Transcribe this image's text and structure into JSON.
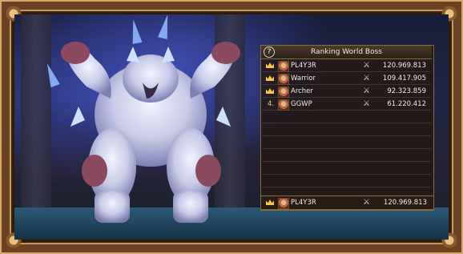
{
  "panel": {
    "title": "Ranking World Boss",
    "help_icon": "question-circle-icon",
    "rows": [
      {
        "rank": "",
        "name": "PL4Y3R",
        "score": "120.969.813"
      },
      {
        "rank": "",
        "name": "Warrior",
        "score": "109.417.905"
      },
      {
        "rank": "",
        "name": "Archer",
        "score": "92.323.859"
      },
      {
        "rank": "4.",
        "name": "GGWP",
        "score": "61.220.412"
      }
    ],
    "player": {
      "name": "PL4Y3R",
      "score": "120.969.813"
    }
  }
}
